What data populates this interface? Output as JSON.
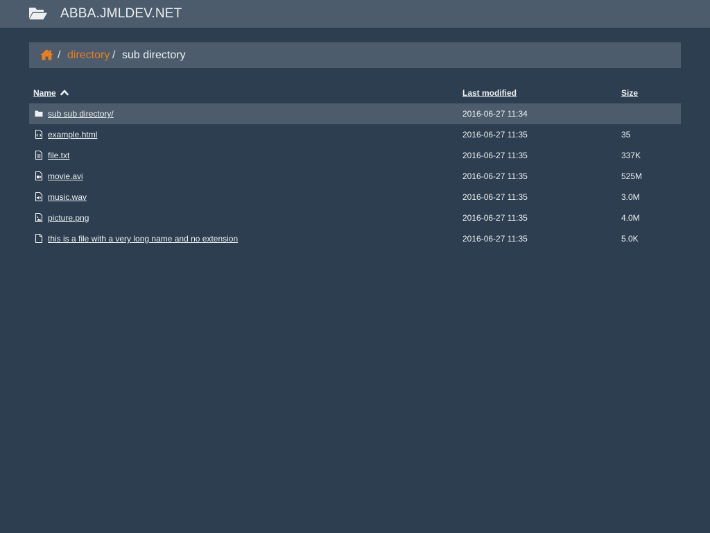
{
  "header": {
    "title": "ABBA.JMLDEV.NET",
    "icon": "folder-open-icon"
  },
  "breadcrumb": {
    "home_icon": "home-icon",
    "separator": "/",
    "items": [
      {
        "label": "directory",
        "link": true
      },
      {
        "label": "sub directory",
        "link": false
      }
    ]
  },
  "table": {
    "columns": {
      "name": "Name",
      "modified": "Last modified",
      "size": "Size"
    },
    "sort": {
      "column": "name",
      "direction": "ascending",
      "icon": "chevron-up-icon"
    },
    "rows": [
      {
        "icon": "folder-icon",
        "name": "sub sub directory/",
        "modified": "2016-06-27 11:34",
        "size": ""
      },
      {
        "icon": "code-file-icon",
        "name": "example.html",
        "modified": "2016-06-27 11:35",
        "size": "35"
      },
      {
        "icon": "text-file-icon",
        "name": "file.txt",
        "modified": "2016-06-27 11:35",
        "size": "337K"
      },
      {
        "icon": "video-file-icon",
        "name": "movie.avi",
        "modified": "2016-06-27 11:35",
        "size": "525M"
      },
      {
        "icon": "audio-file-icon",
        "name": "music.wav",
        "modified": "2016-06-27 11:35",
        "size": "3.0M"
      },
      {
        "icon": "image-file-icon",
        "name": "picture.png",
        "modified": "2016-06-27 11:35",
        "size": "4.0M"
      },
      {
        "icon": "file-icon",
        "name": "this is a file with a very long name and no extension",
        "modified": "2016-06-27 11:35",
        "size": "5.0K"
      }
    ]
  },
  "colors": {
    "background": "#2c3e50",
    "bar": "#4c5c6c",
    "accent": "#e67e22",
    "text": "#ecf0f1"
  }
}
